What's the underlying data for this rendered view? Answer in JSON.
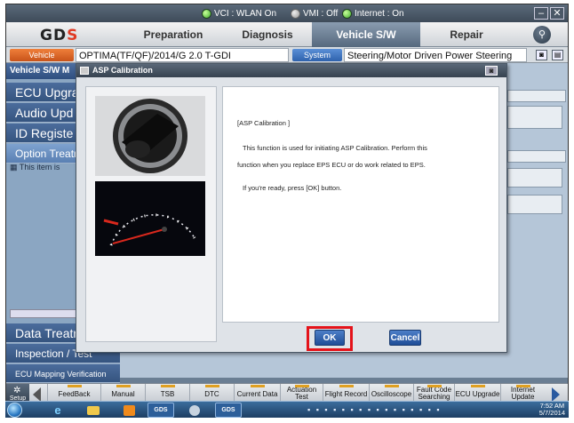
{
  "titlebar": {
    "vci": "VCI : WLAN On",
    "vmi": "VMI : Off",
    "internet": "Internet : On",
    "minimize": "–",
    "close": "✕"
  },
  "nav": {
    "logo_text": "GD",
    "logo_slash": "S",
    "tabs": [
      {
        "label": "Preparation"
      },
      {
        "label": "Diagnosis"
      },
      {
        "label": "Vehicle S/W Management"
      },
      {
        "label": "Repair"
      }
    ],
    "search_glyph": "⚲"
  },
  "vehicle": {
    "pill": "Vehicle",
    "model": "OPTIMA(TF/QF)/2014/G 2.0 T-GDI",
    "system_pill": "System",
    "system": "Steering/Motor Driven Power Steering"
  },
  "sidebar": {
    "header": "Vehicle S/W M",
    "items": [
      {
        "label": "ECU Upgra"
      },
      {
        "label": "Audio Upd"
      },
      {
        "label": "ID Registe"
      },
      {
        "label": "Option Treatm"
      }
    ],
    "note": "This item is",
    "bottom_items": [
      {
        "label": "Data Treatn"
      },
      {
        "label": "Inspection / Test"
      },
      {
        "label": "ECU Mapping Verification"
      }
    ]
  },
  "modal": {
    "title": "ASP Calibration",
    "heading": "[ASP Calibration ]",
    "line1": "This function is used for initiating ASP Calibration. Perform this",
    "line2": "function when you replace EPS ECU or do work related to EPS.",
    "line3": "If you're ready, press [OK] button.",
    "ok": "OK",
    "cancel": "Cancel"
  },
  "toolbar": {
    "setup": "Setup",
    "items": [
      {
        "label": "FeedBack"
      },
      {
        "label": "Manual"
      },
      {
        "label": "TSB"
      },
      {
        "label": "DTC"
      },
      {
        "label": "Current Data"
      },
      {
        "label": "Actuation Test"
      },
      {
        "label": "Flight Record"
      },
      {
        "label": "Oscilloscope"
      },
      {
        "label": "Fault Code Searching"
      },
      {
        "label": "ECU Upgrade"
      },
      {
        "label": "Internet Update"
      }
    ]
  },
  "taskbar": {
    "gds1": "GDS",
    "gds2": "GDS",
    "time": "7:52 AM",
    "date": "5/7/2014"
  },
  "colors": {
    "accent_blue": "#2e62ad",
    "ok_highlight": "#e4131a",
    "status_green": "#3fae2c"
  }
}
